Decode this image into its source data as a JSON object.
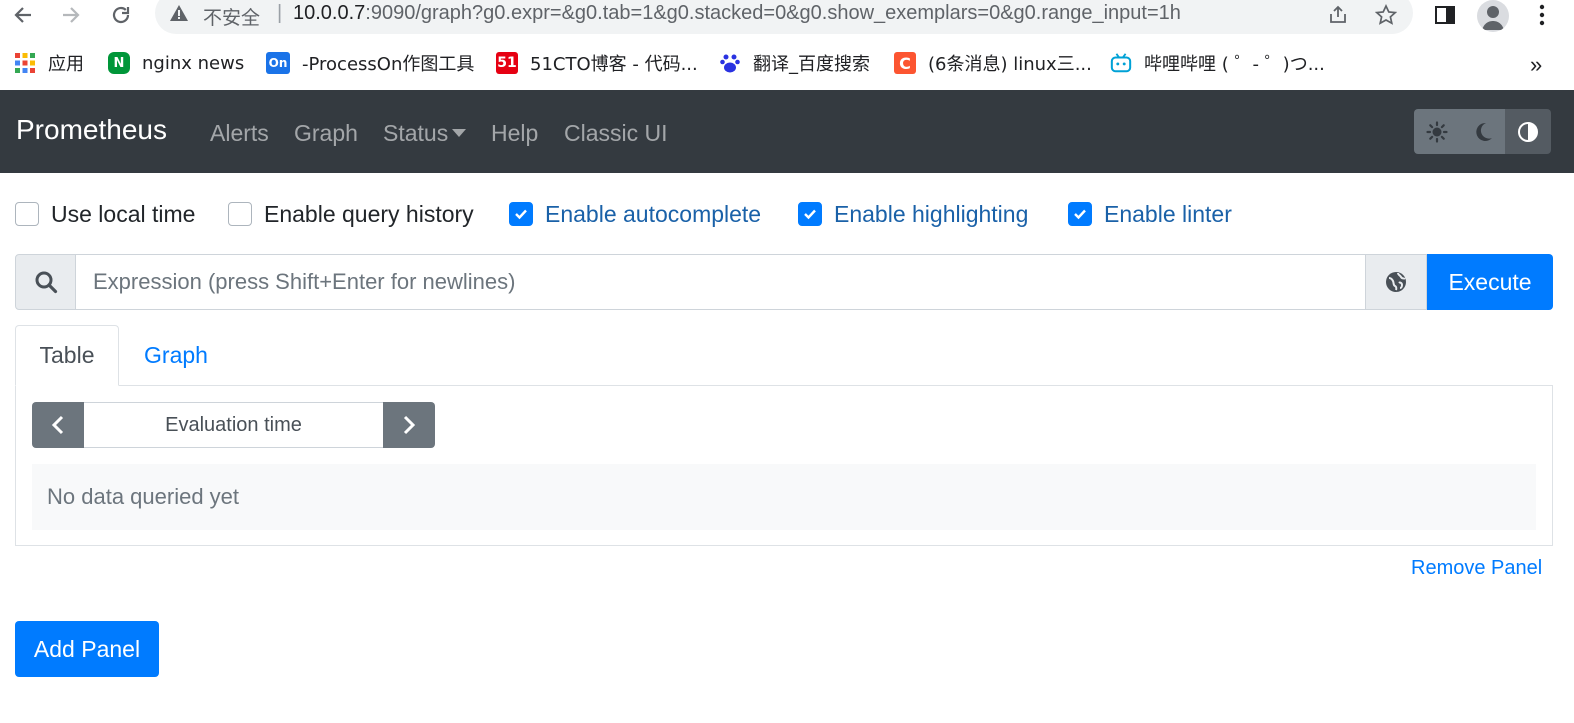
{
  "browser": {
    "insecure_label": "不安全",
    "url_host": "10.0.0.7",
    "url_rest": ":9090/graph?g0.expr=&g0.tab=1&g0.stacked=0&g0.show_exemplars=0&g0.range_input=1h",
    "bookmarks": [
      {
        "label": "应用",
        "icon": "apps-grid-icon",
        "color": "#ea4335"
      },
      {
        "label": "nginx news",
        "icon": "nginx-icon",
        "color": "#009639"
      },
      {
        "label": "-ProcessOn作图工具",
        "icon": "processon-icon",
        "color": "#1a73e8"
      },
      {
        "label": "51CTO博客 - 代码...",
        "icon": "51cto-icon",
        "color": "#e60012"
      },
      {
        "label": "翻译_百度搜索",
        "icon": "baidu-paw-icon",
        "color": "#2932e1"
      },
      {
        "label": "(6条消息) linux三...",
        "icon": "csdn-icon",
        "color": "#fc5531"
      },
      {
        "label": "哔哩哔哩 ( ゜- ゜)つ...",
        "icon": "bilibili-icon",
        "color": "#00a1d6"
      }
    ],
    "more_label": "»"
  },
  "navbar": {
    "brand": "Prometheus",
    "links": {
      "alerts": "Alerts",
      "graph": "Graph",
      "status": "Status",
      "help": "Help",
      "classic": "Classic UI"
    }
  },
  "options": {
    "local_time": "Use local time",
    "query_history": "Enable query history",
    "autocomplete": "Enable autocomplete",
    "highlighting": "Enable highlighting",
    "linter": "Enable linter"
  },
  "expression": {
    "placeholder": "Expression (press Shift+Enter for newlines)",
    "execute": "Execute"
  },
  "panel": {
    "tabs": {
      "table": "Table",
      "graph": "Graph"
    },
    "eval_time": "Evaluation time",
    "no_data": "No data queried yet",
    "remove": "Remove Panel"
  },
  "add_panel": "Add Panel",
  "colors": {
    "navbar": "#343a40",
    "primary": "#007bff",
    "secondary": "#6c757d"
  }
}
